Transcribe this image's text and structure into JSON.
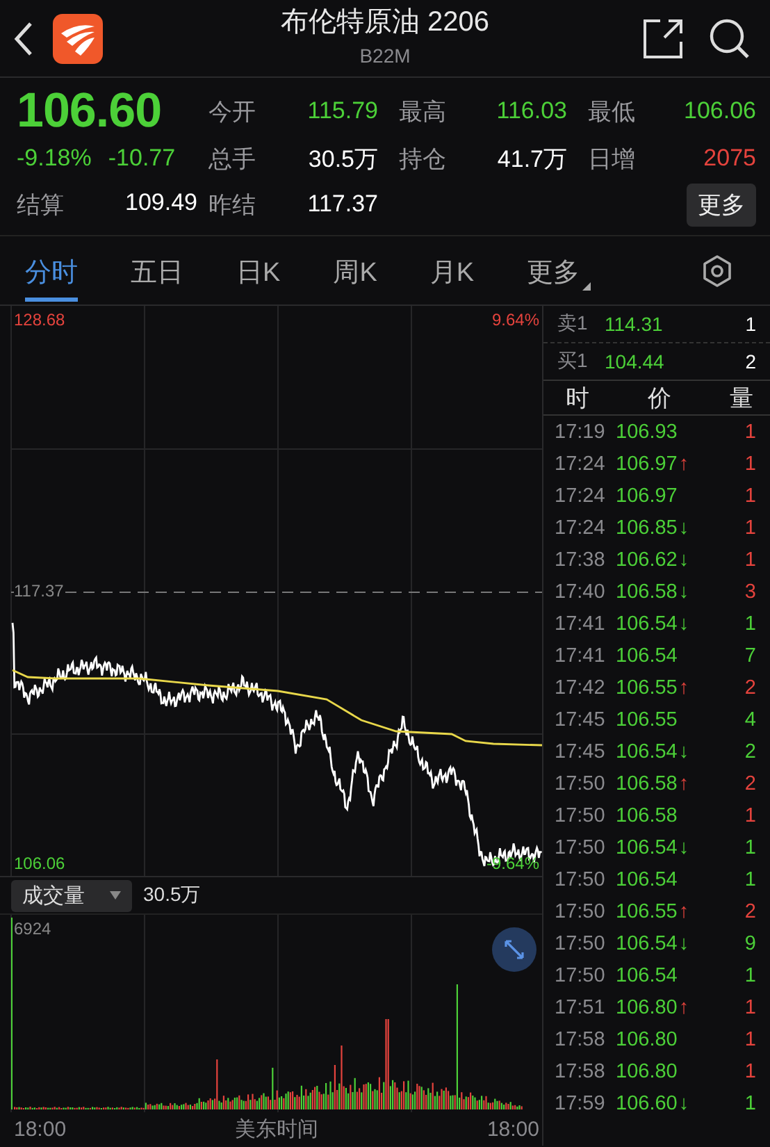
{
  "header": {
    "title": "布伦特原油 2206",
    "code": "B22M"
  },
  "quote": {
    "price": "106.60",
    "change_pct": "-9.18%",
    "change": "-10.77",
    "stats": [
      {
        "label": "今开",
        "value": "115.79",
        "color": "#4cd038"
      },
      {
        "label": "最高",
        "value": "116.03",
        "color": "#4cd038"
      },
      {
        "label": "最低",
        "value": "106.06",
        "color": "#4cd038"
      },
      {
        "label": "总手",
        "value": "30.5万",
        "color": "#ffffff"
      },
      {
        "label": "持仓",
        "value": "41.7万",
        "color": "#ffffff"
      },
      {
        "label": "日增",
        "value": "2075",
        "color": "#e5433d"
      },
      {
        "label": "结算",
        "value": "109.49",
        "color": "#ffffff"
      },
      {
        "label": "昨结",
        "value": "117.37",
        "color": "#ffffff"
      }
    ],
    "more_button": "更多"
  },
  "tabs": [
    {
      "label": "分时",
      "selected": true
    },
    {
      "label": "五日",
      "selected": false
    },
    {
      "label": "日K",
      "selected": false
    },
    {
      "label": "周K",
      "selected": false
    },
    {
      "label": "月K",
      "selected": false
    },
    {
      "label": "更多",
      "selected": false,
      "kind": "dropdown"
    }
  ],
  "chart": {
    "high_price": "128.68",
    "high_pct": "9.64%",
    "ref_price": "117.37",
    "low_price": "106.06",
    "low_pct": "-9.64%"
  },
  "order_book": [
    {
      "side": "卖1",
      "price": "114.31",
      "qty": "1"
    },
    {
      "side": "买1",
      "price": "104.44",
      "qty": "2"
    }
  ],
  "trade_columns": [
    "时",
    "价",
    "量"
  ],
  "trades": [
    {
      "time": "17:19",
      "price": "106.93",
      "qty": "1",
      "color": "#e5433d"
    },
    {
      "time": "17:24",
      "price": "106.97",
      "arrow": {
        "symbol": "↑",
        "color": "#e5433d"
      },
      "qty": "1",
      "color": "#e5433d"
    },
    {
      "time": "17:24",
      "price": "106.97",
      "qty": "1",
      "color": "#e5433d"
    },
    {
      "time": "17:24",
      "price": "106.85",
      "arrow": {
        "symbol": "↓",
        "color": "#4cd038"
      },
      "qty": "1",
      "color": "#e5433d"
    },
    {
      "time": "17:38",
      "price": "106.62",
      "arrow": {
        "symbol": "↓",
        "color": "#4cd038"
      },
      "qty": "1",
      "color": "#e5433d"
    },
    {
      "time": "17:40",
      "price": "106.58",
      "arrow": {
        "symbol": "↓",
        "color": "#4cd038"
      },
      "qty": "3",
      "color": "#e5433d"
    },
    {
      "time": "17:41",
      "price": "106.54",
      "arrow": {
        "symbol": "↓",
        "color": "#4cd038"
      },
      "qty": "1",
      "color": "#4cd038"
    },
    {
      "time": "17:41",
      "price": "106.54",
      "qty": "7",
      "color": "#4cd038"
    },
    {
      "time": "17:42",
      "price": "106.55",
      "arrow": {
        "symbol": "↑",
        "color": "#e5433d"
      },
      "qty": "2",
      "color": "#e5433d"
    },
    {
      "time": "17:45",
      "price": "106.55",
      "qty": "4",
      "color": "#4cd038"
    },
    {
      "time": "17:45",
      "price": "106.54",
      "arrow": {
        "symbol": "↓",
        "color": "#4cd038"
      },
      "qty": "2",
      "color": "#4cd038"
    },
    {
      "time": "17:50",
      "price": "106.58",
      "arrow": {
        "symbol": "↑",
        "color": "#e5433d"
      },
      "qty": "2",
      "color": "#e5433d"
    },
    {
      "time": "17:50",
      "price": "106.58",
      "qty": "1",
      "color": "#e5433d"
    },
    {
      "time": "17:50",
      "price": "106.54",
      "arrow": {
        "symbol": "↓",
        "color": "#4cd038"
      },
      "qty": "1",
      "color": "#4cd038"
    },
    {
      "time": "17:50",
      "price": "106.54",
      "qty": "1",
      "color": "#4cd038"
    },
    {
      "time": "17:50",
      "price": "106.55",
      "arrow": {
        "symbol": "↑",
        "color": "#e5433d"
      },
      "qty": "2",
      "color": "#e5433d"
    },
    {
      "time": "17:50",
      "price": "106.54",
      "arrow": {
        "symbol": "↓",
        "color": "#4cd038"
      },
      "qty": "9",
      "color": "#4cd038"
    },
    {
      "time": "17:50",
      "price": "106.54",
      "qty": "1",
      "color": "#4cd038"
    },
    {
      "time": "17:51",
      "price": "106.80",
      "arrow": {
        "symbol": "↑",
        "color": "#e5433d"
      },
      "qty": "1",
      "color": "#e5433d"
    },
    {
      "time": "17:58",
      "price": "106.80",
      "qty": "1",
      "color": "#e5433d"
    },
    {
      "time": "17:58",
      "price": "106.80",
      "qty": "1",
      "color": "#e5433d"
    },
    {
      "time": "17:59",
      "price": "106.60",
      "arrow": {
        "symbol": "↓",
        "color": "#4cd038"
      },
      "qty": "1",
      "color": "#4cd038"
    }
  ],
  "volume": {
    "selector": "成交量",
    "total": "30.5万",
    "max_label": "6924",
    "time_axis": [
      "18:00",
      "美东时间",
      "18:00"
    ]
  }
}
